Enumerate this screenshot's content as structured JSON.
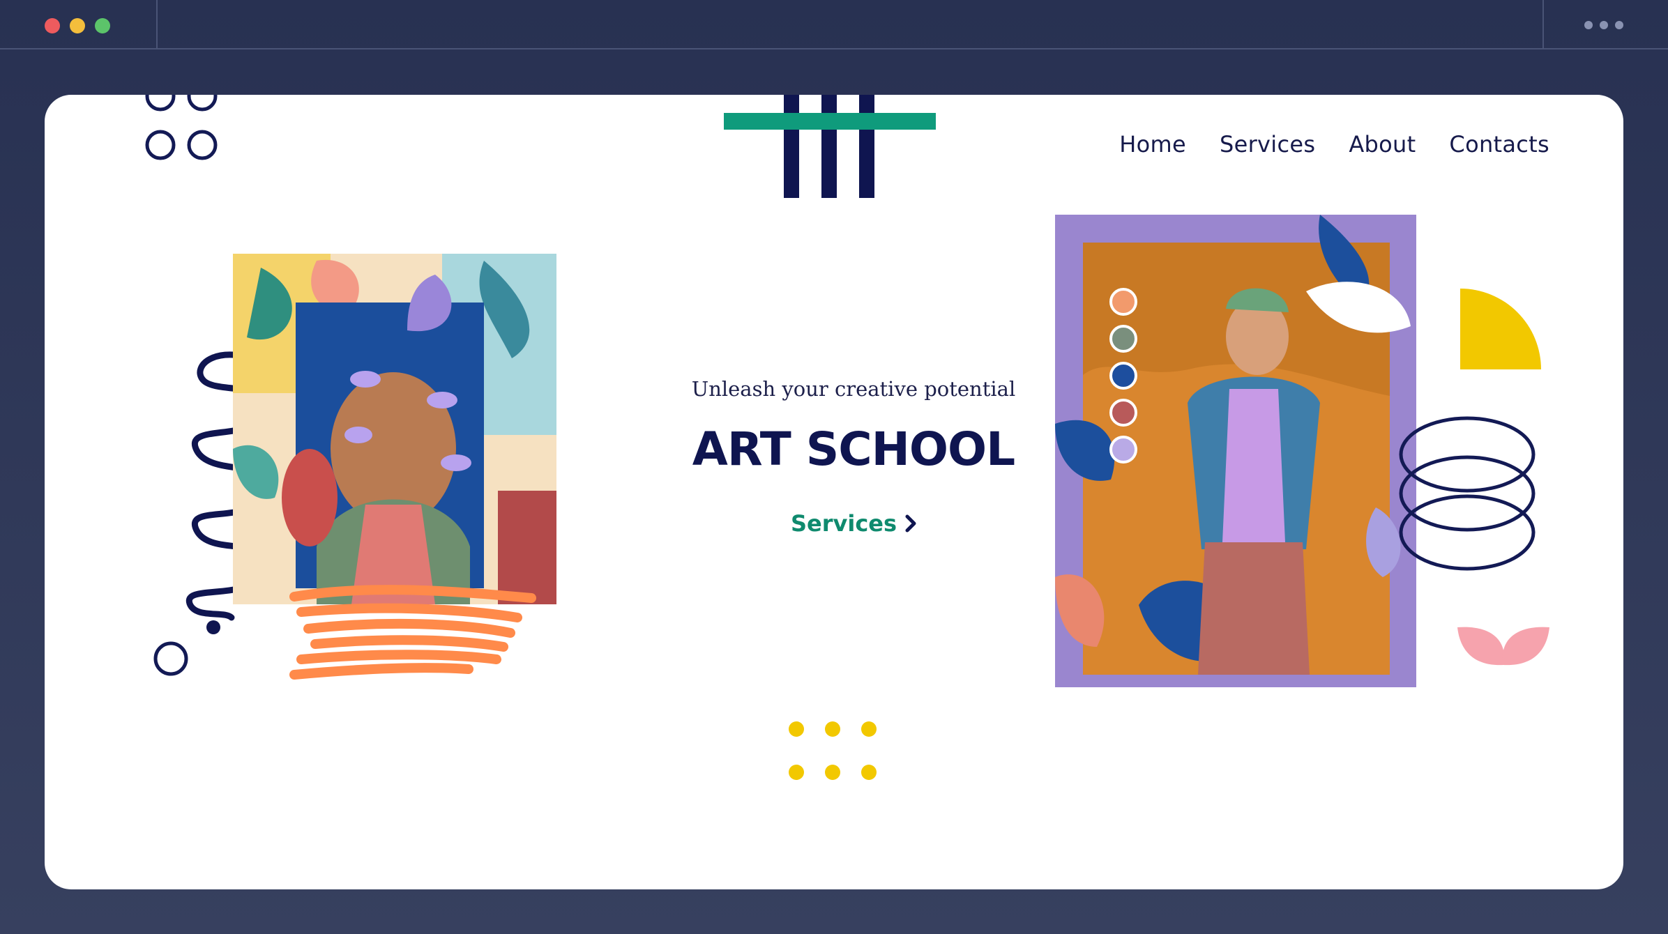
{
  "window": {
    "controls": [
      "close",
      "minimize",
      "maximize"
    ],
    "more_icon": "more-dots-icon"
  },
  "colors": {
    "frame": "#2c3456",
    "card": "#ffffff",
    "navy": "#0f1550",
    "green": "#0f9b7c",
    "yellow": "#f2c800",
    "orange": "#ff8a4a",
    "pink": "#f6a3ad",
    "lavender": "#c7a6ec"
  },
  "nav": {
    "home": "Home",
    "services": "Services",
    "about": "About",
    "contacts": "Contacts"
  },
  "hero": {
    "tagline": "Unleash your creative potential",
    "title": "ART SCHOOL",
    "cta_label": "Services",
    "cta_icon": "chevron-right-icon"
  },
  "images": {
    "left": "portrait-collage-flowers",
    "right": "fashion-collage-green-cap"
  }
}
